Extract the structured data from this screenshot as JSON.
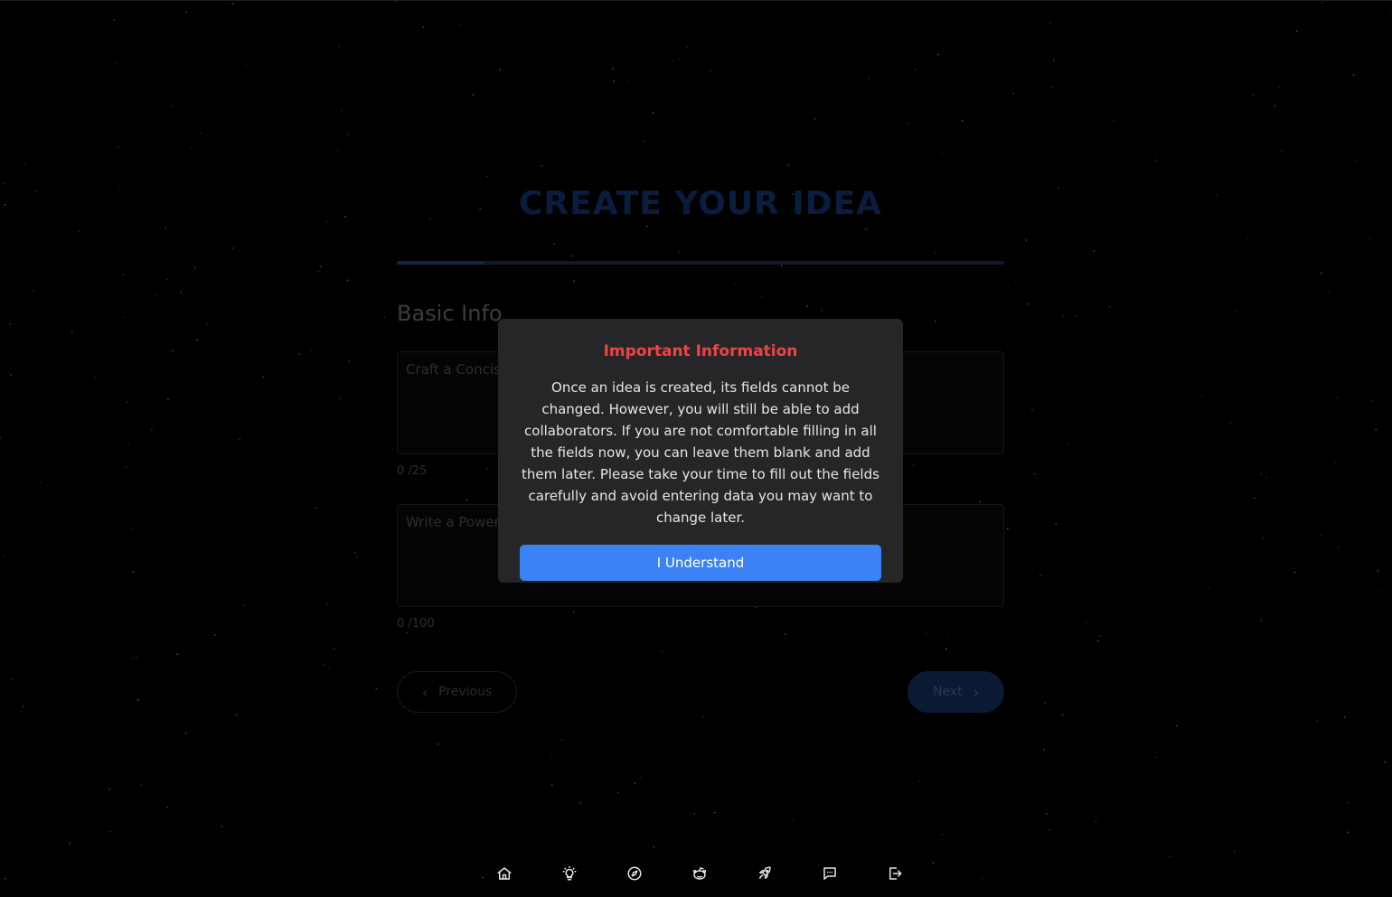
{
  "page": {
    "title": "CREATE YOUR IDEA",
    "progress_fraction": 0.143
  },
  "form": {
    "section_title": "Basic Info",
    "title_field": {
      "placeholder": "Craft a Concise",
      "counter": "0 /25"
    },
    "description_field": {
      "placeholder": "Write a Power",
      "counter": "0 /100"
    },
    "prev_label": "Previous",
    "next_label": "Next"
  },
  "modal": {
    "title": "Important Information",
    "body": "Once an idea is created, its fields cannot be changed. However, you will still be able to add collaborators. If you are not comfortable filling in all the fields now, you can leave them blank and add them later. Please take your time to fill out the fields carefully and avoid entering data you may want to change later.",
    "button_label": "I Understand"
  },
  "nav": {
    "icons": [
      "home-icon",
      "lightbulb-icon",
      "compass-icon",
      "reddit-icon",
      "rocket-icon",
      "chat-icon",
      "logout-icon"
    ]
  },
  "colors": {
    "accent": "#3b82f6",
    "modal_title": "#ef4444",
    "modal_bg": "#262628",
    "background": "#000000"
  }
}
